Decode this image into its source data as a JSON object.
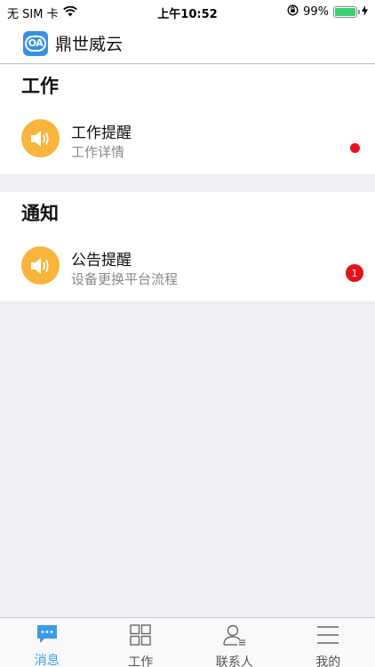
{
  "status_bar": {
    "carrier": "无 SIM 卡",
    "time": "上午10:52",
    "battery": "99%",
    "battery_level": 0.99
  },
  "header": {
    "logo_text": "OA",
    "title": "鼎世威云"
  },
  "sections": [
    {
      "title": "工作",
      "items": [
        {
          "title": "工作提醒",
          "subtitle": "工作详情",
          "indicator": "dot"
        }
      ]
    },
    {
      "title": "通知",
      "items": [
        {
          "title": "公告提醒",
          "subtitle": "设备更换平台流程",
          "badge": "1"
        }
      ]
    }
  ],
  "tabs": [
    {
      "label": "消息",
      "icon": "chat-icon",
      "active": true
    },
    {
      "label": "工作",
      "icon": "grid-icon",
      "active": false
    },
    {
      "label": "联系人",
      "icon": "contacts-icon",
      "active": false
    },
    {
      "label": "我的",
      "icon": "menu-icon",
      "active": false
    }
  ],
  "colors": {
    "accent": "#3b9ce8",
    "icon_bg": "#f7b53b",
    "badge": "#e8101a",
    "battery": "#3cd070"
  }
}
